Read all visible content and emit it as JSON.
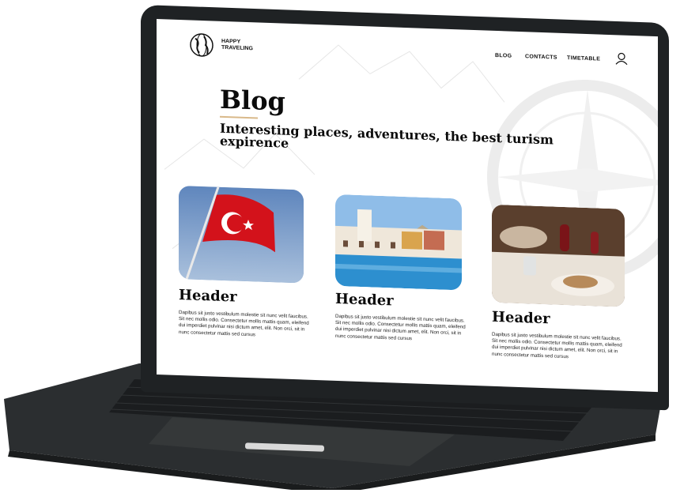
{
  "brand": {
    "line1": "HAPPY",
    "line2": "TRAVELING"
  },
  "nav": {
    "blog": "BLOG",
    "contacts": "CONTACTS",
    "timetable": "TIMETABLE"
  },
  "hero": {
    "title": "Blog",
    "subtitle_line1": "Interesting places, adventures, the best turism",
    "subtitle_line2": "expirence"
  },
  "cards": [
    {
      "header": "Header",
      "image": "turkish-flag",
      "text": "Dapibus sit justo vestibulum molestie sit nunc velit faucibus. Sit nec mollis odio. Consectetur mollis mattis quam, eleifend dui imperdiet pulvinar nisi dictum amet, elit. Non orci, sit in nunc consectetur mattis sed cursus"
    },
    {
      "header": "Header",
      "image": "hotel-pool",
      "text": "Dapibus sit justo vestibulum molestie sit nunc velit faucibus. Sit nec mollis odio. Consectetur mollis mattis quam, eleifend dui imperdiet pulvinar nisi dictum amet, elit. Non orci, sit in nunc consectetur mattis sed cursus"
    },
    {
      "header": "Header",
      "image": "dinner-table",
      "text": "Dapibus sit justo vestibulum molestie sit nunc velit faucibus. Sit nec mollis odio. Consectetur mollis mattis quam, eleifend dui imperdiet pulvinar nisi dictum amet, elit. Non orci, sit in nunc consectetur mattis sed cursus"
    }
  ],
  "icons": {
    "logo": "globe-icon",
    "account": "user-icon"
  },
  "colors": {
    "laptop_body": "#2a2d2f",
    "bezel": "#1f2224",
    "accent_underline": "#d9b98a",
    "flag_red": "#d3121b"
  }
}
